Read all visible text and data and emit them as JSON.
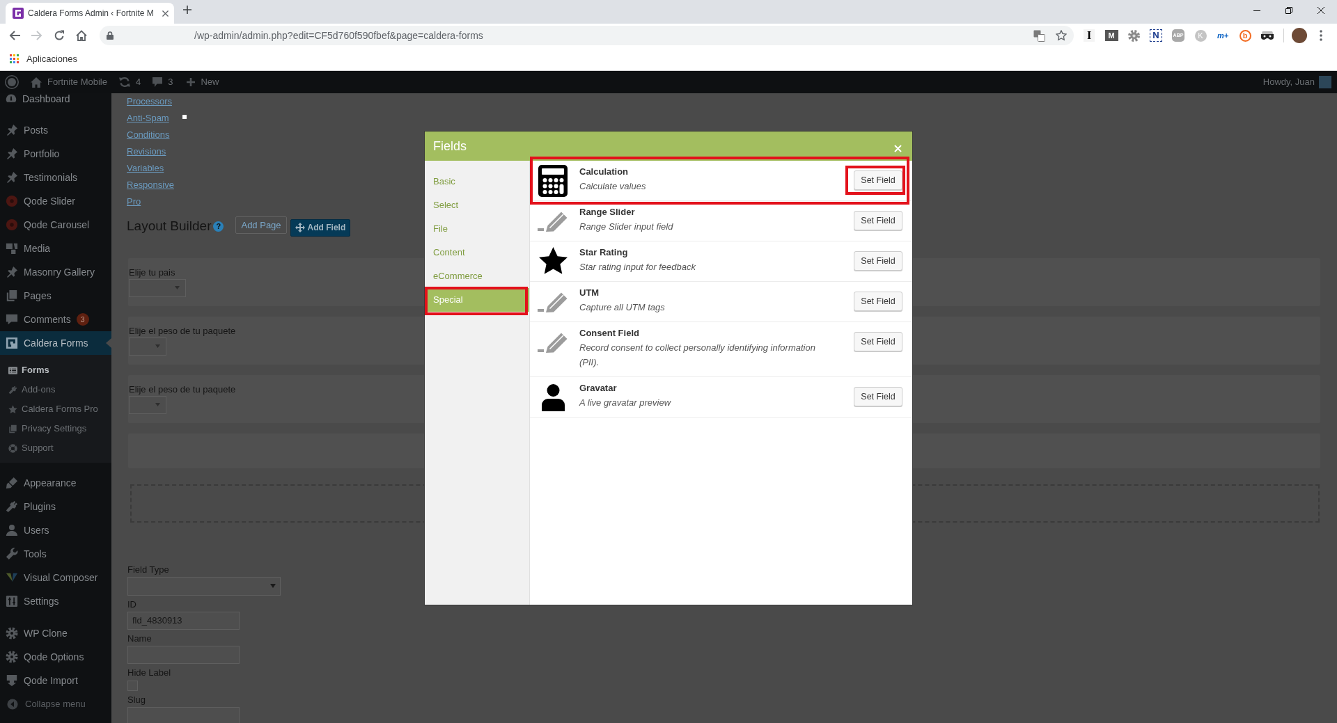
{
  "browser": {
    "tab_title": "Caldera Forms Admin ‹ Fortnite M",
    "nav_buttons": [
      {
        "kind": "back",
        "disabled": false
      },
      {
        "kind": "forward",
        "disabled": true
      },
      {
        "kind": "reload",
        "disabled": false
      },
      {
        "kind": "home",
        "disabled": false
      }
    ],
    "url": "/wp-admin/admin.php?edit=CF5d760f590fbef&page=caldera-forms",
    "extensions": [
      {
        "kind": "serif",
        "text": "I"
      },
      {
        "kind": "tile",
        "text": "M"
      },
      {
        "kind": "gear"
      },
      {
        "kind": "frame",
        "text": "N"
      },
      {
        "kind": "octagon",
        "text": "ABP"
      },
      {
        "kind": "disc",
        "text": "K"
      },
      {
        "kind": "script",
        "text": "m+"
      },
      {
        "kind": "ring",
        "text": "b"
      },
      {
        "kind": "mask"
      }
    ],
    "bookmarks": [
      {
        "label": "Aplicaciones"
      }
    ]
  },
  "admin_bar": {
    "site": "Fortnite Mobile",
    "updates": "4",
    "comments": "3",
    "new": "New",
    "greeting": "Howdy, Juan"
  },
  "sidebar": {
    "groups": [
      {
        "items": [
          {
            "label": "Dashboard",
            "selected": false
          }
        ]
      },
      {
        "items": [
          {
            "label": "Posts",
            "selected": false
          },
          {
            "label": "Portfolio",
            "selected": false
          },
          {
            "label": "Testimonials",
            "selected": false
          },
          {
            "label": "Qode Slider",
            "selected": false
          },
          {
            "label": "Qode Carousel",
            "selected": false
          },
          {
            "label": "Media",
            "selected": false
          },
          {
            "label": "Masonry Gallery",
            "selected": false
          },
          {
            "label": "Pages",
            "selected": false
          },
          {
            "label": "Comments",
            "selected": false,
            "badge": "3"
          },
          {
            "label": "Caldera Forms",
            "selected": true,
            "children": [
              {
                "label": "Forms",
                "selected": true
              },
              {
                "label": "Add-ons",
                "selected": false
              },
              {
                "label": "Caldera Forms Pro",
                "selected": false
              },
              {
                "label": "Privacy Settings",
                "selected": false
              },
              {
                "label": "Support",
                "selected": false
              }
            ]
          }
        ]
      },
      {
        "items": [
          {
            "label": "Appearance",
            "selected": false
          },
          {
            "label": "Plugins",
            "selected": false
          },
          {
            "label": "Users",
            "selected": false
          },
          {
            "label": "Tools",
            "selected": false
          },
          {
            "label": "Visual Composer",
            "selected": false
          },
          {
            "label": "Settings",
            "selected": false
          }
        ]
      },
      {
        "items": [
          {
            "label": "WP Clone",
            "selected": false
          },
          {
            "label": "Qode Options",
            "selected": false
          },
          {
            "label": "Qode Import",
            "selected": false
          }
        ]
      }
    ],
    "collapse": {
      "label": "Collapse menu"
    }
  },
  "editor_links": [
    {
      "label": "Processors"
    },
    {
      "label": "Anti-Spam"
    },
    {
      "label": "Conditions"
    },
    {
      "label": "Revisions"
    },
    {
      "label": "Variables"
    },
    {
      "label": "Responsive"
    },
    {
      "label": "Pro"
    }
  ],
  "layout_builder": {
    "title": "Layout Builder",
    "help": "?",
    "buttons": [
      {
        "label": "Add Page",
        "kind": "secondary"
      },
      {
        "label": "Add Field",
        "kind": "primary"
      }
    ],
    "rows": [
      {
        "label": "Elije tu pais"
      },
      {
        "label": "Elije el peso de tu paquete"
      },
      {
        "label": "Elije el peso de tu paquete"
      }
    ]
  },
  "field_settings": {
    "field_type": {
      "label": "Field Type"
    },
    "id": {
      "label": "ID",
      "value": "fld_4830913"
    },
    "name": {
      "label": "Name"
    },
    "hide_label": {
      "label": "Hide Label",
      "checked": false
    },
    "slug": {
      "label": "Slug"
    }
  },
  "modal": {
    "title": "Fields",
    "categories": [
      {
        "label": "Basic",
        "selected": false,
        "highlighted": false
      },
      {
        "label": "Select",
        "selected": false,
        "highlighted": false
      },
      {
        "label": "File",
        "selected": false,
        "highlighted": false
      },
      {
        "label": "Content",
        "selected": false,
        "highlighted": false
      },
      {
        "label": "eCommerce",
        "selected": false,
        "highlighted": false
      },
      {
        "label": "Special",
        "selected": true,
        "highlighted": true
      }
    ],
    "fields": [
      {
        "name": "Calculation",
        "description": "Calculate values",
        "highlighted": true,
        "button": {
          "label": "Set Field",
          "highlighted": true
        }
      },
      {
        "name": "Range Slider",
        "description": "Range Slider input field",
        "highlighted": false,
        "button": {
          "label": "Set Field",
          "highlighted": false
        }
      },
      {
        "name": "Star Rating",
        "description": "Star rating input for feedback",
        "highlighted": false,
        "button": {
          "label": "Set Field",
          "highlighted": false
        }
      },
      {
        "name": "UTM",
        "description": "Capture all UTM tags",
        "highlighted": false,
        "button": {
          "label": "Set Field",
          "highlighted": false
        }
      },
      {
        "name": "Consent Field",
        "description": "Record consent to collect personally identifying information (PII).",
        "highlighted": false,
        "button": {
          "label": "Set Field",
          "highlighted": false
        }
      },
      {
        "name": "Gravatar",
        "description": "A live gravatar preview",
        "highlighted": false,
        "button": {
          "label": "Set Field",
          "highlighted": false
        }
      }
    ]
  }
}
